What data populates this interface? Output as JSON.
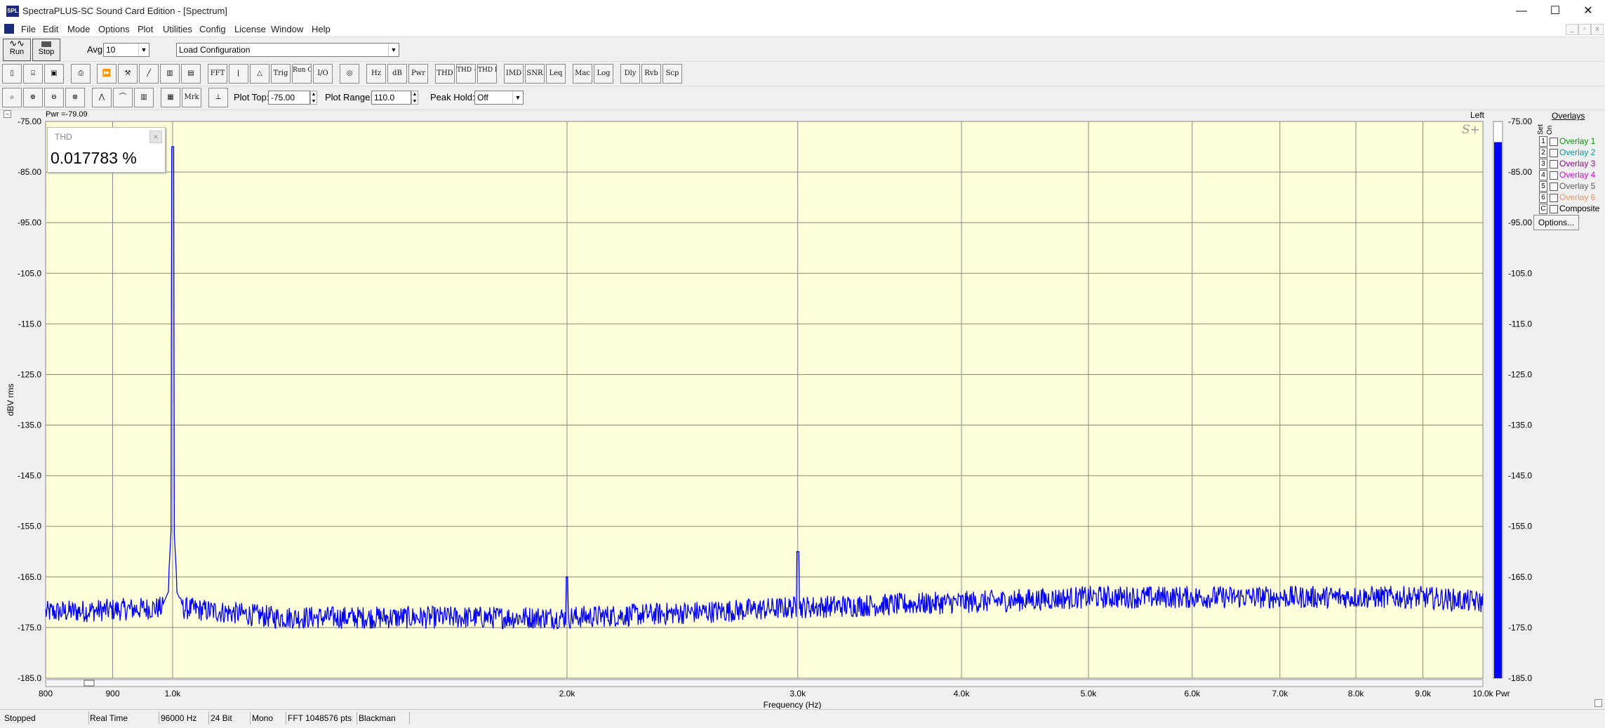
{
  "window": {
    "title": "SpectraPLUS-SC Sound Card Edition - [Spectrum]",
    "app_icon_text": "SPL",
    "minimize": "—",
    "maximize": "☐",
    "close": "✕"
  },
  "menu": [
    "File",
    "Edit",
    "Mode",
    "Options",
    "Plot",
    "Utilities",
    "Config",
    "License",
    "Window",
    "Help"
  ],
  "toolbar1": {
    "run_label": "Run",
    "stop_label": "Stop",
    "avg_label": "Avg",
    "avg_value": "10",
    "config_value": "Load Configuration"
  },
  "toolbar2": {
    "buttons": [
      "FFT",
      "Trig",
      "Run Ctrl",
      "I/O",
      "Hz",
      "dB",
      "Pwr",
      "THD",
      "THD +N",
      "THD Freq",
      "IMD",
      "SNR",
      "Leq",
      "Mac",
      "Log",
      "Dly",
      "Rvb",
      "Scp"
    ]
  },
  "toolbar3": {
    "buttons": [
      "Mrk"
    ],
    "plot_top_label": "Plot Top:",
    "plot_top_value": "-75.00",
    "plot_range_label": "Plot Range:",
    "plot_range_value": "110.0",
    "peak_hold_label": "Peak Hold:",
    "peak_hold_value": "Off"
  },
  "plot": {
    "pwr_readout": "Pwr =-79.09",
    "channel_label": "Left",
    "thd_title": "THD",
    "thd_value": "0.017783 %",
    "pwr_axis_label": "Pwr",
    "colors": {
      "trace": "#0000ff",
      "background": "#ffffd9",
      "grid": "#888888",
      "meter": "#0000ff"
    }
  },
  "chart_data": {
    "type": "line",
    "ylabel": "dBV rms",
    "xlabel": "Frequency (Hz)",
    "x_scale": "log",
    "ylim": [
      -185,
      -75
    ],
    "xlim": [
      800,
      10000
    ],
    "yticks": [
      -75,
      -85,
      -95,
      -105,
      -115,
      -125,
      -135,
      -145,
      -155,
      -165,
      -175,
      -185
    ],
    "ytick_labels": [
      "-75.00",
      "-85.00",
      "-95.00",
      "-105.0",
      "-115.0",
      "-125.0",
      "-135.0",
      "-145.0",
      "-155.0",
      "-165.0",
      "-175.0",
      "-185.0"
    ],
    "xticks": [
      800,
      900,
      1000,
      2000,
      3000,
      4000,
      5000,
      6000,
      7000,
      8000,
      9000,
      10000
    ],
    "xtick_labels": [
      "800",
      "900",
      "1.0k",
      "2.0k",
      "3.0k",
      "4.0k",
      "5.0k",
      "6.0k",
      "7.0k",
      "8.0k",
      "9.0k",
      "10.0k"
    ],
    "grid": true,
    "series": [
      {
        "color": "#0000ff",
        "noise_floor": [
          [
            800,
            -172
          ],
          [
            1000,
            -171
          ],
          [
            1200,
            -173
          ],
          [
            2000,
            -173
          ],
          [
            3000,
            -171
          ],
          [
            4000,
            -170
          ],
          [
            5000,
            -169
          ],
          [
            6000,
            -169
          ],
          [
            7000,
            -169
          ],
          [
            8000,
            -169
          ],
          [
            9000,
            -169
          ],
          [
            10000,
            -170
          ]
        ],
        "peaks": [
          {
            "x": 1000,
            "y": -80
          },
          {
            "x": 2000,
            "y": -165
          },
          {
            "x": 3000,
            "y": -160
          }
        ]
      }
    ],
    "meter": {
      "label": "Pwr",
      "value": -79.09
    }
  },
  "meter_axis": {
    "labels": [
      "-75.00",
      "-85.00",
      "-95.00",
      "-105.0",
      "-115.0",
      "-125.0",
      "-135.0",
      "-145.0",
      "-155.0",
      "-165.0",
      "-175.0",
      "-185.0"
    ]
  },
  "overlays": {
    "title": "Overlays",
    "set_label": "Set",
    "on_label": "On",
    "items": [
      {
        "num": "1",
        "label": "Overlay 1",
        "color": "#00a000"
      },
      {
        "num": "2",
        "label": "Overlay 2",
        "color": "#00a0a0"
      },
      {
        "num": "3",
        "label": "Overlay 3",
        "color": "#a000a0"
      },
      {
        "num": "4",
        "label": "Overlay 4",
        "color": "#e000e0"
      },
      {
        "num": "5",
        "label": "Overlay 5",
        "color": "#606060"
      },
      {
        "num": "6",
        "label": "Overlay 6",
        "color": "#f09060"
      },
      {
        "num": "C",
        "label": "Composite",
        "color": "#000000"
      }
    ],
    "options_label": "Options..."
  },
  "status": [
    "Stopped",
    "Real Time",
    "96000 Hz",
    "24 Bit",
    "Mono",
    "FFT 1048576 pts",
    "Blackman"
  ]
}
